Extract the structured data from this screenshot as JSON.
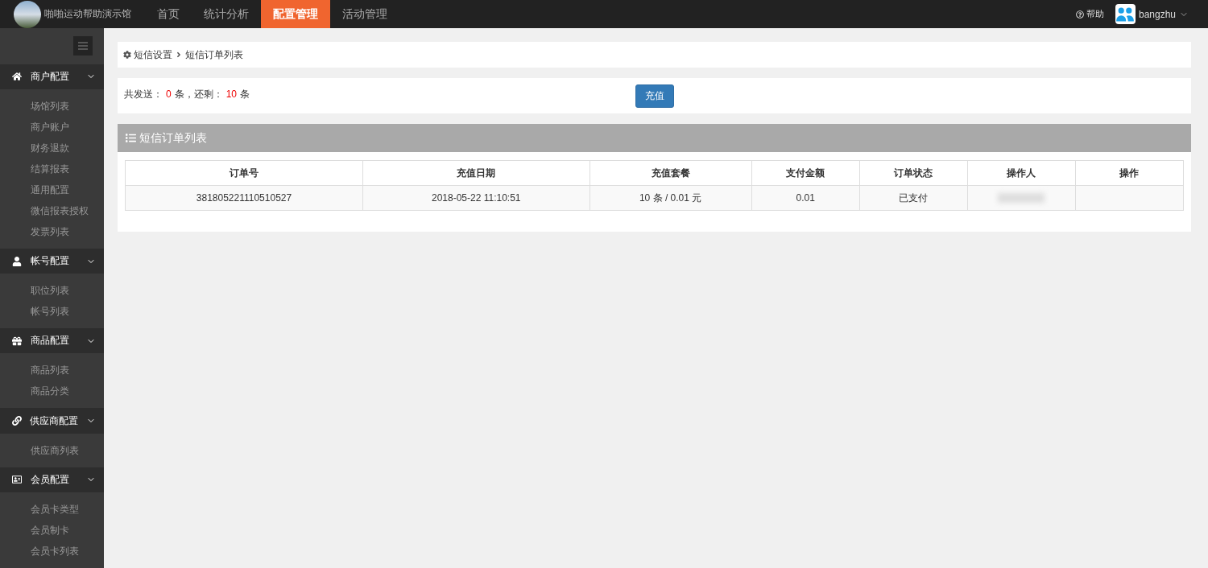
{
  "brand": {
    "title": "啪啪运动帮助演示馆"
  },
  "nav": [
    {
      "label": "首页",
      "selected": false
    },
    {
      "label": "统计分析",
      "selected": false
    },
    {
      "label": "配置管理",
      "selected": true
    },
    {
      "label": "活动管理",
      "selected": false
    }
  ],
  "help": "帮助",
  "user": {
    "name": "bangzhu"
  },
  "sidebar": {
    "groups": [
      {
        "label": "商户配置",
        "expanded": true,
        "items": [
          "场馆列表",
          "商户账户",
          "财务退款",
          "结算报表",
          "通用配置",
          "微信报表授权",
          "发票列表"
        ]
      },
      {
        "label": "帐号配置",
        "expanded": true,
        "items": [
          "职位列表",
          "帐号列表"
        ]
      },
      {
        "label": "商品配置",
        "expanded": true,
        "items": [
          "商品列表",
          "商品分类"
        ]
      },
      {
        "label": "供应商配置",
        "expanded": true,
        "items": [
          "供应商列表"
        ]
      },
      {
        "label": "会员配置",
        "expanded": true,
        "items": [
          "会员卡类型",
          "会员制卡",
          "会员卡列表"
        ]
      }
    ]
  },
  "breadcrumb": [
    "短信设置",
    "短信订单列表"
  ],
  "summary": {
    "sent_label": "共发送：",
    "sent": "0",
    "sent_unit": "条，还剩：",
    "remaining": "10",
    "remaining_unit": "条",
    "button": "充值"
  },
  "table": {
    "title": "短信订单列表",
    "columns": [
      "订单号",
      "充值日期",
      "充值套餐",
      "支付金额",
      "订单状态",
      "操作人",
      "操作"
    ],
    "rows": [
      {
        "cells": [
          "381805221110510527",
          "2018-05-22 11:10:51",
          "10 条 / 0.01 元",
          "0.01",
          "已支付"
        ],
        "operator_redacted": true
      }
    ]
  }
}
